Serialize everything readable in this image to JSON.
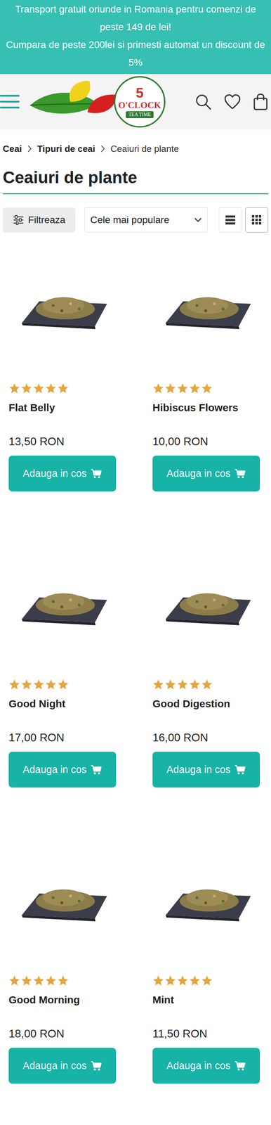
{
  "banner": {
    "lines": [
      "Transport gratuit oriunde in Romania pentru comenzi de peste 149 de lei!",
      "Cumpara de peste 200lei si primesti automat un discount de 5%"
    ]
  },
  "logo": {
    "number": "5",
    "brand": "O'CLOCK",
    "tagline": "TEA TIME"
  },
  "breadcrumb": [
    "Ceai",
    "Tipuri de ceai",
    "Ceaiuri de plante"
  ],
  "title": "Ceaiuri de plante",
  "toolbar": {
    "filter": "Filtreaza",
    "sort": "Cele mai populare",
    "views": [
      {
        "kind": "list",
        "selected": false
      },
      {
        "kind": "grid",
        "selected": true
      }
    ]
  },
  "products": [
    {
      "name": "Flat Belly",
      "price": "13,50 RON",
      "stars": 5,
      "button": "Adauga in cos"
    },
    {
      "name": "Hibiscus Flowers",
      "price": "10,00 RON",
      "stars": 5,
      "button": "Adauga in cos"
    },
    {
      "name": "Good Night",
      "price": "17,00 RON",
      "stars": 5,
      "button": "Adauga in cos"
    },
    {
      "name": "Good Digestion",
      "price": "16,00 RON",
      "stars": 5,
      "button": "Adauga in cos"
    },
    {
      "name": "Good Morning",
      "price": "18,00 RON",
      "stars": 5,
      "button": "Adauga in cos"
    },
    {
      "name": "Mint",
      "price": "11,50 RON",
      "stars": 5,
      "button": "Adauga in cos"
    }
  ]
}
